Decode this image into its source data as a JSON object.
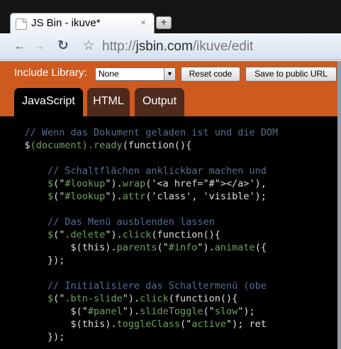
{
  "browser": {
    "tab_title": "JS Bin - ikuve*",
    "tab_close_glyph": "×",
    "new_tab_glyph": "+",
    "back_glyph": "←",
    "forward_glyph": "→",
    "reload_glyph": "↻",
    "bookmark_glyph": "☆",
    "url_scheme": "http://",
    "url_host": "jsbin.com",
    "url_path": "/ikuve/edit"
  },
  "jsbin": {
    "include_label": "Include Library:",
    "library_value": "None",
    "select_arrow_glyph": "▼",
    "reset_button": "Reset code",
    "save_button": "Save to public URL",
    "tabs": [
      "JavaScript",
      "HTML",
      "Output"
    ],
    "active_tab": "JavaScript"
  },
  "colors": {
    "orange_bar": "#cf5a20",
    "editor_background": "#000000",
    "inactive_tab": "#4e2a1d",
    "comment": "#5a6d93",
    "function": "#70a15d",
    "string": "#d47a3c"
  },
  "code_lines": [
    [
      {
        "t": "    // Wenn das Dokument geladen ist und die DOM",
        "k": "c-comment"
      }
    ],
    [
      {
        "t": "    $",
        "k": "c-plain"
      },
      {
        "t": "(document).",
        "k": "c-fn"
      },
      {
        "t": "ready",
        "k": "c-fn"
      },
      {
        "t": "(",
        "k": "c-plain"
      },
      {
        "t": "function",
        "k": "c-plain"
      },
      {
        "t": "(){",
        "k": "c-plain"
      }
    ],
    [
      {
        "t": "",
        "k": "c-plain"
      }
    ],
    [
      {
        "t": "        // Schaltflächen anklickbar machen und",
        "k": "c-comment"
      }
    ],
    [
      {
        "t": "        $",
        "k": "c-fn"
      },
      {
        "t": "(\"",
        "k": "c-plain"
      },
      {
        "t": "#lookup",
        "k": "c-fn"
      },
      {
        "t": "\").",
        "k": "c-plain"
      },
      {
        "t": "wrap",
        "k": "c-fn"
      },
      {
        "t": "('",
        "k": "c-plain"
      },
      {
        "t": "<a href=\"#\"></a>",
        "k": "c-plain"
      },
      {
        "t": "'),",
        "k": "c-plain"
      }
    ],
    [
      {
        "t": "        $",
        "k": "c-fn"
      },
      {
        "t": "(\"",
        "k": "c-plain"
      },
      {
        "t": "#lookup",
        "k": "c-fn"
      },
      {
        "t": "\").",
        "k": "c-plain"
      },
      {
        "t": "attr",
        "k": "c-fn"
      },
      {
        "t": "('class', 'visible');",
        "k": "c-plain"
      }
    ],
    [
      {
        "t": "",
        "k": "c-plain"
      }
    ],
    [
      {
        "t": "        // Das Menü ausblenden lassen",
        "k": "c-comment"
      }
    ],
    [
      {
        "t": "        $",
        "k": "c-fn"
      },
      {
        "t": "(\"",
        "k": "c-plain"
      },
      {
        "t": ".delete",
        "k": "c-fn"
      },
      {
        "t": "\").",
        "k": "c-plain"
      },
      {
        "t": "click",
        "k": "c-fn"
      },
      {
        "t": "(",
        "k": "c-plain"
      },
      {
        "t": "function",
        "k": "c-plain"
      },
      {
        "t": "(){",
        "k": "c-plain"
      }
    ],
    [
      {
        "t": "            $",
        "k": "c-plain"
      },
      {
        "t": "(this).",
        "k": "c-plain"
      },
      {
        "t": "parents",
        "k": "c-fn"
      },
      {
        "t": "(\"",
        "k": "c-plain"
      },
      {
        "t": "#info",
        "k": "c-fn"
      },
      {
        "t": "\").",
        "k": "c-plain"
      },
      {
        "t": "animate",
        "k": "c-fn"
      },
      {
        "t": "({",
        "k": "c-plain"
      }
    ],
    [
      {
        "t": "        });",
        "k": "c-plain"
      }
    ],
    [
      {
        "t": "",
        "k": "c-plain"
      }
    ],
    [
      {
        "t": "        // Initialisiere das Schaltermenü (obe",
        "k": "c-comment"
      }
    ],
    [
      {
        "t": "        $",
        "k": "c-fn"
      },
      {
        "t": "(\"",
        "k": "c-plain"
      },
      {
        "t": ".btn-slide",
        "k": "c-fn"
      },
      {
        "t": "\").",
        "k": "c-plain"
      },
      {
        "t": "click",
        "k": "c-fn"
      },
      {
        "t": "(",
        "k": "c-plain"
      },
      {
        "t": "function",
        "k": "c-plain"
      },
      {
        "t": "(){",
        "k": "c-plain"
      }
    ],
    [
      {
        "t": "            $",
        "k": "c-plain"
      },
      {
        "t": "(\"",
        "k": "c-plain"
      },
      {
        "t": "#panel",
        "k": "c-fn"
      },
      {
        "t": "\").",
        "k": "c-plain"
      },
      {
        "t": "slideToggle",
        "k": "c-fn"
      },
      {
        "t": "(\"",
        "k": "c-plain"
      },
      {
        "t": "slow",
        "k": "c-fn"
      },
      {
        "t": "\");",
        "k": "c-plain"
      }
    ],
    [
      {
        "t": "            $",
        "k": "c-plain"
      },
      {
        "t": "(this).",
        "k": "c-plain"
      },
      {
        "t": "toggleClass",
        "k": "c-fn"
      },
      {
        "t": "(\"",
        "k": "c-plain"
      },
      {
        "t": "active",
        "k": "c-fn"
      },
      {
        "t": "\"); ret",
        "k": "c-plain"
      }
    ],
    [
      {
        "t": "        });",
        "k": "c-plain"
      }
    ]
  ]
}
